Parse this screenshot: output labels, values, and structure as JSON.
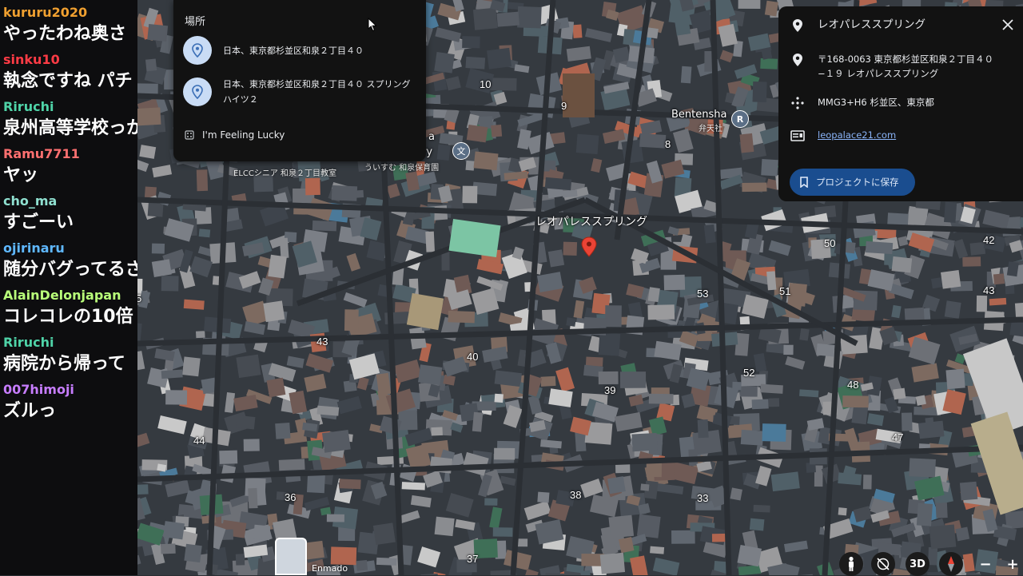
{
  "chat": [
    {
      "user": "kururu2020",
      "color": "#f0a030",
      "text": "やったわね奥さ"
    },
    {
      "user": "sinku10",
      "color": "#ff3b45",
      "text": "執念ですね パチ"
    },
    {
      "user": "Riruchi",
      "color": "#4fd3a8",
      "text": "泉州高等学校っか？"
    },
    {
      "user": "Ramu7711",
      "color": "#ff7070",
      "text": "ヤッ"
    },
    {
      "user": "cho_ma",
      "color": "#8fe0d0",
      "text": "すごーい"
    },
    {
      "user": "ojirinaru",
      "color": "#5fb8ff",
      "text": "随分バグってるざす"
    },
    {
      "user": "AlainDelonjapan",
      "color": "#b9ff7a",
      "text": "コレコレの10倍"
    },
    {
      "user": "Riruchi",
      "color": "#4fd3a8",
      "text": "病院から帰って"
    },
    {
      "user": "007himoji",
      "color": "#c77dff",
      "text": "ズルっ"
    }
  ],
  "suggest": {
    "header": "場所",
    "items": [
      {
        "text": "日本、東京都杉並区和泉２丁目４０",
        "icon": "map-pin-icon"
      },
      {
        "text": "日本、東京都杉並区和泉２丁目４０ スプリングハイツ２",
        "icon": "map-pin-icon"
      }
    ],
    "lucky": "I'm Feeling Lucky"
  },
  "info": {
    "title": "レオパレススプリング",
    "address": "〒168-0063 東京都杉並区和泉２丁目４０−１９ レオパレススプリング",
    "plus_code": "MMG3+H6 杉並区、東京都",
    "website": "leopalace21.com",
    "save_label": "プロジェクトに保存"
  },
  "map": {
    "marker_label": "レオパレススプリング",
    "poi_bentensha": "Bentensha",
    "poi_bentensha_sub": "弁天社",
    "poi_school_sub": "ELCCシニア 和泉２丁目教室",
    "poi_nursery_sub": "ういすむ 和泉保育園",
    "poi_nursery_frag": "ery",
    "poi_a_frag": "a",
    "numbers": [
      "10",
      "9",
      "8",
      "50",
      "42",
      "43",
      "53",
      "51",
      "43",
      "40",
      "52",
      "48",
      "39",
      "44",
      "47",
      "36",
      "38",
      "33",
      "37",
      "5"
    ],
    "thumb_label": "Enmado"
  },
  "controls": {
    "three_d": "3D",
    "minus": "−",
    "plus": "+"
  },
  "colors": {
    "panel_bg": "#121212",
    "accent": "#8ab4f8",
    "save_bg": "#1a4d8f",
    "marker": "#ea4335"
  }
}
